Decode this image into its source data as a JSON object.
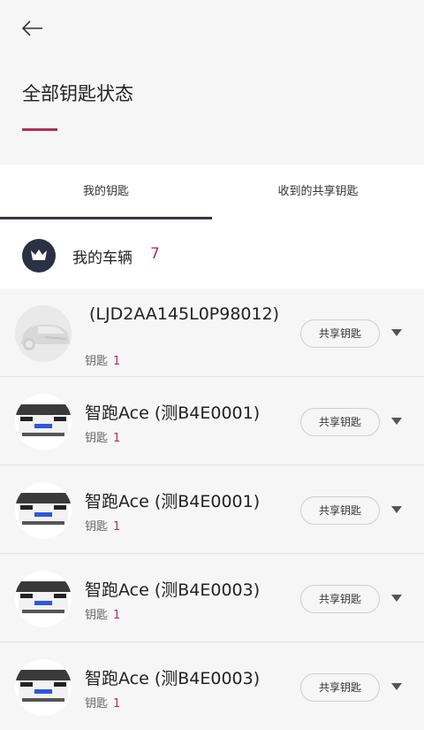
{
  "header": {
    "title": "全部钥匙状态"
  },
  "tabs": [
    {
      "label": "我的钥匙",
      "active": true
    },
    {
      "label": "收到的共享钥匙",
      "active": false
    }
  ],
  "section": {
    "title": "我的车辆",
    "count": "7"
  },
  "cards": [
    {
      "name": "(LJD2AA145L0P98012)",
      "key_label": "钥匙",
      "key_count": "1",
      "share_label": "共享钥匙",
      "thumb": "generic-car-icon"
    },
    {
      "name": "智跑Ace (测B4E0001)",
      "key_label": "钥匙",
      "key_count": "1",
      "share_label": "共享钥匙",
      "thumb": "car-photo"
    },
    {
      "name": "智跑Ace (测B4E0001)",
      "key_label": "钥匙",
      "key_count": "1",
      "share_label": "共享钥匙",
      "thumb": "car-photo"
    },
    {
      "name": "智跑Ace (测B4E0003)",
      "key_label": "钥匙",
      "key_count": "1",
      "share_label": "共享钥匙",
      "thumb": "car-photo"
    },
    {
      "name": "智跑Ace (测B4E0003)",
      "key_label": "钥匙",
      "key_count": "1",
      "share_label": "共享钥匙",
      "thumb": "car-photo"
    }
  ],
  "colors": {
    "accent": "#b0305a",
    "tab_indicator": "#333a44",
    "crown_bg": "#2b3142"
  }
}
